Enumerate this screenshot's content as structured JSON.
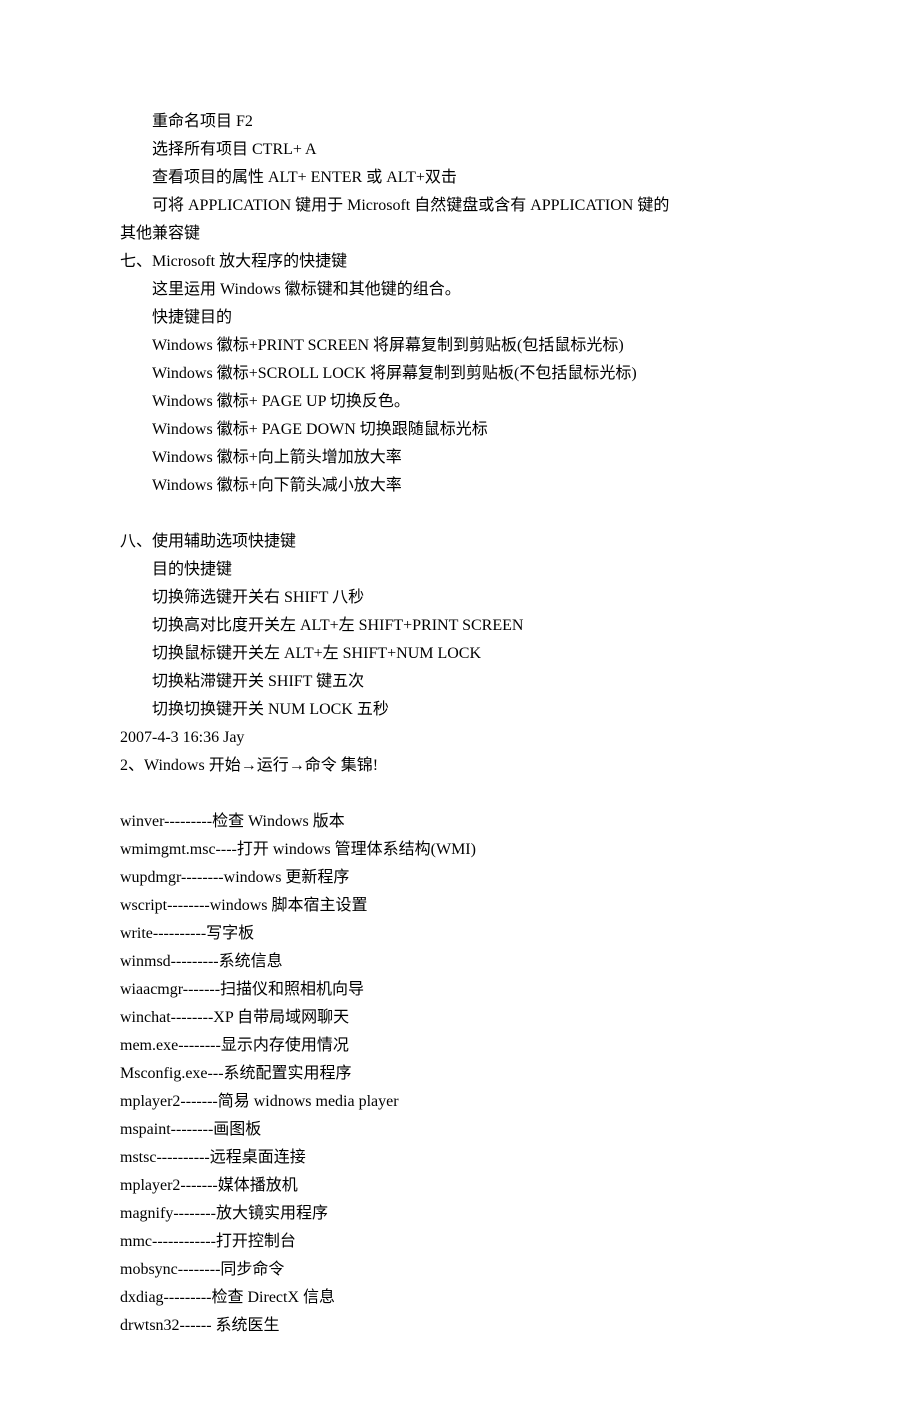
{
  "lines": [
    {
      "indent": 1,
      "text": "重命名项目 F2"
    },
    {
      "indent": 1,
      "text": "选择所有项目 CTRL+ A"
    },
    {
      "indent": 1,
      "text": "查看项目的属性 ALT+ ENTER 或 ALT+双击"
    },
    {
      "indent": 1,
      "text": "可将 APPLICATION 键用于 Microsoft 自然键盘或含有 APPLICATION 键的"
    },
    {
      "indent": 0,
      "text": "其他兼容键"
    },
    {
      "indent": 0,
      "text": "七、Microsoft 放大程序的快捷键"
    },
    {
      "indent": 1,
      "text": "这里运用 Windows 徽标键和其他键的组合。"
    },
    {
      "indent": 1,
      "text": "快捷键目的"
    },
    {
      "indent": 1,
      "text": "Windows 徽标+PRINT SCREEN 将屏幕复制到剪贴板(包括鼠标光标)"
    },
    {
      "indent": 1,
      "text": "Windows 徽标+SCROLL LOCK 将屏幕复制到剪贴板(不包括鼠标光标)"
    },
    {
      "indent": 1,
      "text": "Windows 徽标+ PAGE UP 切换反色。"
    },
    {
      "indent": 1,
      "text": "Windows 徽标+ PAGE DOWN 切换跟随鼠标光标"
    },
    {
      "indent": 1,
      "text": "Windows 徽标+向上箭头增加放大率"
    },
    {
      "indent": 1,
      "text": "Windows 徽标+向下箭头减小放大率"
    },
    {
      "blank": true
    },
    {
      "indent": 0,
      "text": "八、使用辅助选项快捷键"
    },
    {
      "indent": 1,
      "text": "目的快捷键"
    },
    {
      "indent": 1,
      "text": "切换筛选键开关右 SHIFT 八秒"
    },
    {
      "indent": 1,
      "text": "切换高对比度开关左 ALT+左 SHIFT+PRINT SCREEN"
    },
    {
      "indent": 1,
      "text": "切换鼠标键开关左 ALT+左 SHIFT+NUM LOCK"
    },
    {
      "indent": 1,
      "text": "切换粘滞键开关 SHIFT 键五次"
    },
    {
      "indent": 1,
      "text": "切换切换键开关 NUM LOCK 五秒"
    },
    {
      "indent": 0,
      "text": "2007-4-3 16:36 Jay"
    },
    {
      "indent": 0,
      "text": "2、Windows 开始→运行→命令 集锦!"
    },
    {
      "blank": true
    },
    {
      "indent": 0,
      "text": "winver---------检查 Windows 版本"
    },
    {
      "indent": 0,
      "text": "wmimgmt.msc----打开 windows 管理体系结构(WMI)"
    },
    {
      "indent": 0,
      "text": "wupdmgr--------windows 更新程序"
    },
    {
      "indent": 0,
      "text": "wscript--------windows 脚本宿主设置"
    },
    {
      "indent": 0,
      "text": "write----------写字板"
    },
    {
      "indent": 0,
      "text": "winmsd---------系统信息"
    },
    {
      "indent": 0,
      "text": "wiaacmgr-------扫描仪和照相机向导"
    },
    {
      "indent": 0,
      "text": "winchat--------XP 自带局域网聊天"
    },
    {
      "indent": 0,
      "text": "mem.exe--------显示内存使用情况"
    },
    {
      "indent": 0,
      "text": "Msconfig.exe---系统配置实用程序"
    },
    {
      "indent": 0,
      "text": "mplayer2-------简易 widnows media player"
    },
    {
      "indent": 0,
      "text": "mspaint--------画图板"
    },
    {
      "indent": 0,
      "text": "mstsc----------远程桌面连接"
    },
    {
      "indent": 0,
      "text": "mplayer2-------媒体播放机"
    },
    {
      "indent": 0,
      "text": "magnify--------放大镜实用程序"
    },
    {
      "indent": 0,
      "text": "mmc------------打开控制台"
    },
    {
      "indent": 0,
      "text": "mobsync--------同步命令"
    },
    {
      "indent": 0,
      "text": "dxdiag---------检查 DirectX 信息"
    },
    {
      "indent": 0,
      "text": "drwtsn32------ 系统医生"
    }
  ]
}
